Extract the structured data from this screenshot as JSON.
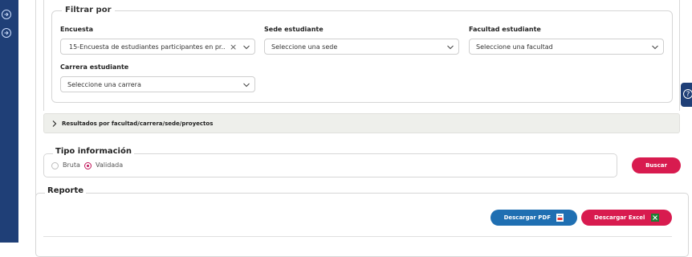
{
  "filter": {
    "legend": "Filtrar por",
    "encuesta": {
      "label": "Encuesta",
      "value": "15-Encuesta de estudiantes participantes en pr..."
    },
    "sede": {
      "label": "Sede estudiante",
      "placeholder": "Seleccione una sede"
    },
    "facultad": {
      "label": "Facultad estudiante",
      "placeholder": "Seleccione una facultad"
    },
    "carrera": {
      "label": "Carrera estudiante",
      "placeholder": "Seleccione una carrera"
    }
  },
  "accordion": {
    "label": "Resultados por facultad/carrera/sede/proyectos"
  },
  "tipo": {
    "legend": "Tipo información",
    "options": [
      {
        "label": "Bruta",
        "checked": false
      },
      {
        "label": "Validada",
        "checked": true
      }
    ]
  },
  "buttons": {
    "buscar": "Buscar",
    "pdf": "Descargar PDF",
    "excel": "Descargar Excel"
  },
  "reporte": {
    "legend": "Reporte"
  },
  "icons": {
    "sidebar": [
      "arrow-right-circle-icon",
      "arrow-right-circle-icon"
    ],
    "pdf": "pdf-file-icon",
    "excel": "excel-file-icon",
    "help": "help-icon"
  },
  "colors": {
    "sidebar": "#1f3f77",
    "primary_pink": "#d81b4f",
    "primary_blue": "#1f6fb2"
  }
}
